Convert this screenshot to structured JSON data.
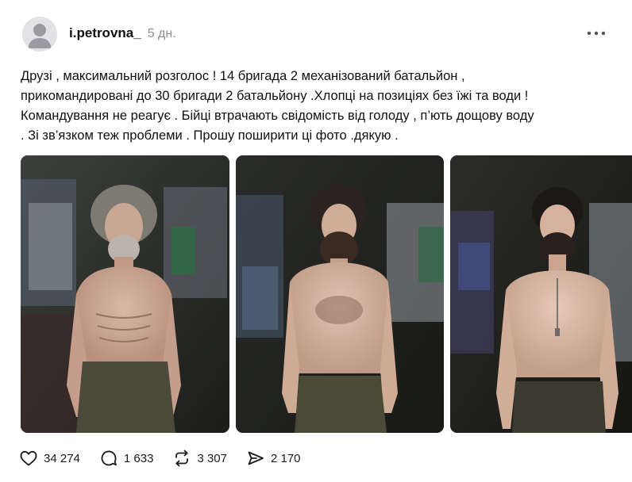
{
  "post": {
    "username": "i.petrovna_",
    "timestamp": "5 дн.",
    "text": "Друзі , максимальний розголос ! 14 бригада 2 механізований батальйон ,\nприкомандировані до 30 бригади 2 батальйону .Хлопці на позиціях без їжі та води !\nКомандування не реагує . Бійці втрачають свідомість від голоду , п’ють дощову воду\n. Зі зв’язком теж проблеми . Прошу поширити ці фото .дякую ."
  },
  "actions": {
    "likes": "34 274",
    "replies": "1 633",
    "reposts": "3 307",
    "shares": "2 170"
  },
  "icons": {
    "avatar": "default-avatar-icon",
    "more": "more-horizontal-icon",
    "like": "heart-icon",
    "reply": "comment-bubble-icon",
    "repost": "repost-arrows-icon",
    "share": "send-arrow-icon"
  },
  "colors": {
    "text": "#101010",
    "muted": "#8c8c8c",
    "avatar_bg": "#e3e3e6"
  }
}
